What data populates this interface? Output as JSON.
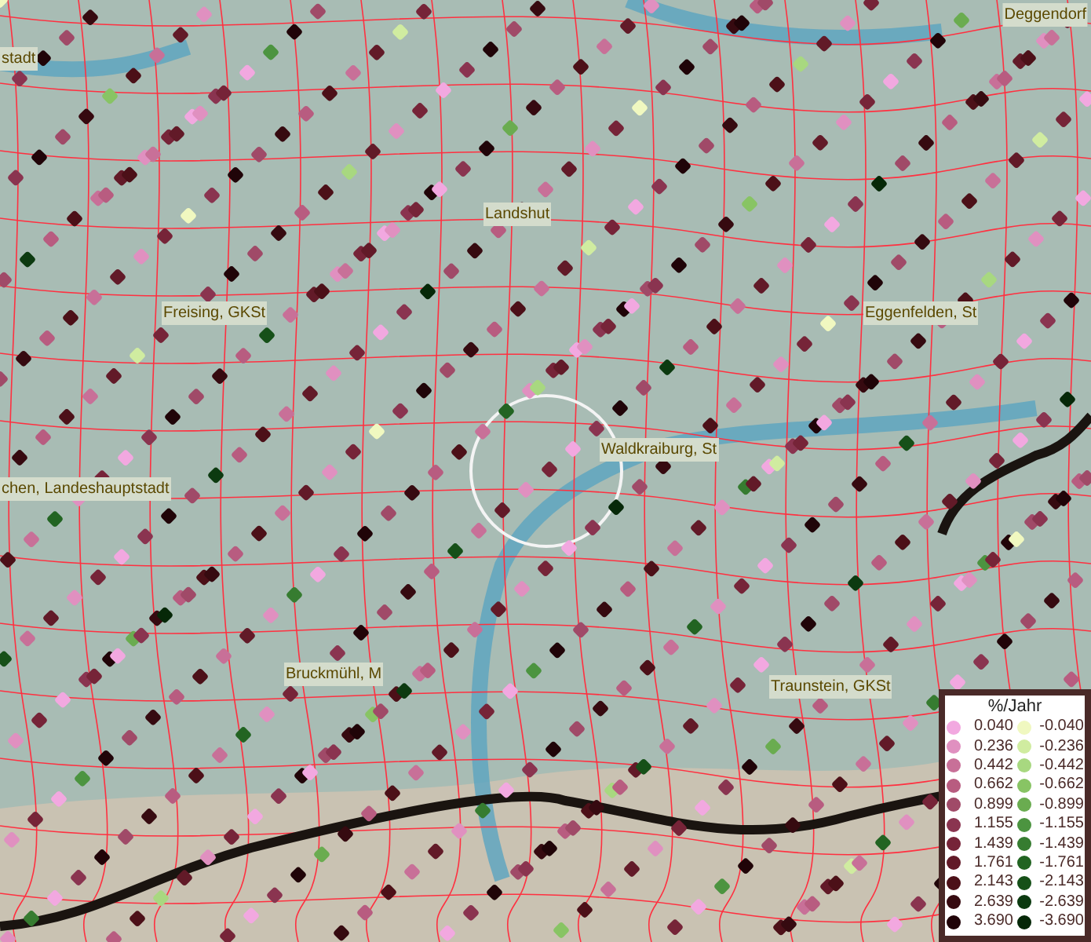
{
  "map": {
    "places": [
      {
        "name": "Deggendorf",
        "kind": "town"
      },
      {
        "name": "stadt",
        "kind": "town"
      },
      {
        "name": "Landshut",
        "kind": "town"
      },
      {
        "name": "Freising, GKSt",
        "kind": "town"
      },
      {
        "name": "Eggenfelden, St",
        "kind": "town"
      },
      {
        "name": "Waldkraiburg, St",
        "kind": "town"
      },
      {
        "name": "chen, Landeshauptstadt",
        "kind": "town"
      },
      {
        "name": "Bruckmühl, M",
        "kind": "town"
      },
      {
        "name": "Traunstein, GKSt",
        "kind": "town"
      }
    ]
  },
  "legend": {
    "title": "%/Jahr",
    "columns": [
      [
        {
          "label": "0.040",
          "color": "#f2a8e0"
        },
        {
          "label": "0.236",
          "color": "#e090c0"
        },
        {
          "label": "0.442",
          "color": "#c87098"
        },
        {
          "label": "0.662",
          "color": "#b85c80"
        },
        {
          "label": "0.899",
          "color": "#a04a68"
        },
        {
          "label": "1.155",
          "color": "#8a3450"
        },
        {
          "label": "1.439",
          "color": "#762438"
        },
        {
          "label": "1.761",
          "color": "#621a28"
        },
        {
          "label": "2.143",
          "color": "#4c1018"
        },
        {
          "label": "2.639",
          "color": "#360a10"
        },
        {
          "label": "3.690",
          "color": "#200408"
        }
      ],
      [
        {
          "label": "-0.040",
          "color": "#f0f8c0"
        },
        {
          "label": "-0.236",
          "color": "#d0eca0"
        },
        {
          "label": "-0.442",
          "color": "#a8d880"
        },
        {
          "label": "-0.662",
          "color": "#88c464"
        },
        {
          "label": "-0.899",
          "color": "#6aac50"
        },
        {
          "label": "-1.155",
          "color": "#4c9440"
        },
        {
          "label": "-1.439",
          "color": "#367c30"
        },
        {
          "label": "-1.761",
          "color": "#226422"
        },
        {
          "label": "-2.143",
          "color": "#165018"
        },
        {
          "label": "-2.639",
          "color": "#0c3a10"
        },
        {
          "label": "-3.690",
          "color": "#062808"
        }
      ]
    ]
  }
}
